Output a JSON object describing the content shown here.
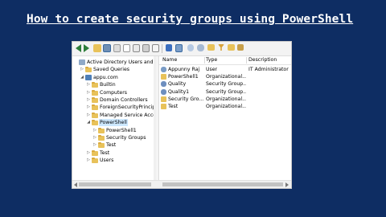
{
  "video_title": "How to create security groups using PowerShell",
  "colors": {
    "background": "#0e2d63",
    "folder": "#e8c25a",
    "selection": "#cde8ff"
  },
  "toolbar": {
    "icons": [
      "back-arrow-icon",
      "forward-arrow-icon",
      "up-folder-icon",
      "console-tree-icon",
      "copy-icon",
      "delete-icon",
      "properties-icon",
      "refresh-icon",
      "export-icon",
      "help-icon",
      "console-icon",
      "new-user-icon",
      "new-group-icon",
      "new-ou-icon",
      "filter-icon",
      "find-icon",
      "add-to-group-icon"
    ]
  },
  "tree": {
    "items": [
      {
        "label": "Active Directory Users and Com",
        "icon": "ad-root-icon",
        "level": 0,
        "expander": ""
      },
      {
        "label": "Saved Queries",
        "icon": "folder-icon",
        "level": 1,
        "expander": "▷"
      },
      {
        "label": "appu.com",
        "icon": "domain-icon",
        "level": 1,
        "expander": "◢"
      },
      {
        "label": "Builtin",
        "icon": "folder-icon",
        "level": 2,
        "expander": "▷"
      },
      {
        "label": "Computers",
        "icon": "folder-icon",
        "level": 2,
        "expander": "▷"
      },
      {
        "label": "Domain Controllers",
        "icon": "folder-icon",
        "level": 2,
        "expander": "▷"
      },
      {
        "label": "ForeignSecurityPrincipal",
        "icon": "folder-icon",
        "level": 2,
        "expander": "▷"
      },
      {
        "label": "Managed Service Accour",
        "icon": "folder-icon",
        "level": 2,
        "expander": "▷"
      },
      {
        "label": "PowerShell",
        "icon": "folder-icon",
        "level": 2,
        "expander": "◢",
        "selected": true
      },
      {
        "label": "PowerShell1",
        "icon": "folder-icon",
        "level": 3,
        "expander": "▷"
      },
      {
        "label": "Security Groups",
        "icon": "folder-icon",
        "level": 3,
        "expander": "▷"
      },
      {
        "label": "Test",
        "icon": "folder-icon",
        "level": 3,
        "expander": "▷"
      },
      {
        "label": "Test",
        "icon": "folder-icon",
        "level": 2,
        "expander": "▷"
      },
      {
        "label": "Users",
        "icon": "folder-icon",
        "level": 2,
        "expander": "▷"
      }
    ]
  },
  "list": {
    "columns": [
      "Name",
      "Type",
      "Description"
    ],
    "rows": [
      {
        "name": "Appunny Raj",
        "type": "User",
        "description": "IT Administrator",
        "icon": "user-icon"
      },
      {
        "name": "PowerShell1",
        "type": "Organizational...",
        "description": "",
        "icon": "ou-icon"
      },
      {
        "name": "Quality",
        "type": "Security Group...",
        "description": "",
        "icon": "group-icon"
      },
      {
        "name": "Quality1",
        "type": "Security Group...",
        "description": "",
        "icon": "group-icon"
      },
      {
        "name": "Security Gro...",
        "type": "Organizational...",
        "description": "",
        "icon": "ou-icon"
      },
      {
        "name": "Test",
        "type": "Organizational...",
        "description": "",
        "icon": "ou-icon"
      }
    ]
  }
}
